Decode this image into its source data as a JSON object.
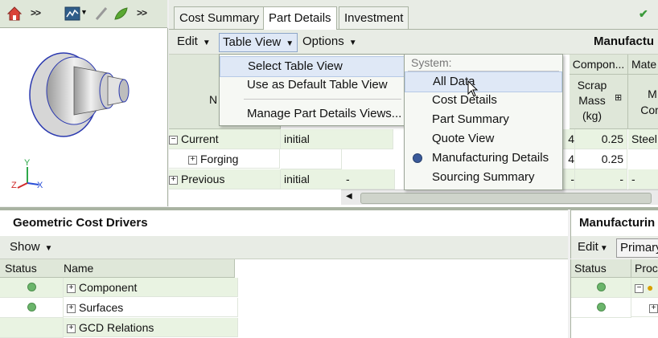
{
  "toolbar_left": {
    "chevron1": ">>",
    "chevron2": ">>"
  },
  "axes": {
    "x": "X",
    "y": "Y",
    "z": "Z"
  },
  "tabs": [
    {
      "label": "Cost Summary"
    },
    {
      "label": "Part Details"
    },
    {
      "label": "Investment"
    }
  ],
  "menubar": {
    "edit": "Edit",
    "table_view": "Table View",
    "options": "Options",
    "right_title": "Manufactu"
  },
  "table_view_menu": {
    "select": "Select Table View",
    "default": "Use as Default Table View",
    "manage": "Manage Part Details Views..."
  },
  "system_menu": {
    "header": "System:",
    "items": [
      "All Data",
      "Cost Details",
      "Part Summary",
      "Quote View",
      "Manufacturing Details",
      "Sourcing Summary"
    ],
    "selected": "Manufacturing Details",
    "hover": "All Data"
  },
  "grid": {
    "col_name_partial": "N",
    "col_compon": "Compon...",
    "col_mate": "Mate",
    "col_scrap": "Scrap Mass (kg)",
    "col_m_com": "M Com",
    "rows": [
      {
        "name": "Current",
        "scenario": "initial",
        "mid": "",
        "p": "4",
        "scrap": "0.25",
        "mat": "Steel",
        "expand": "−"
      },
      {
        "name": "Forging",
        "scenario": "",
        "mid": "",
        "p": "4",
        "scrap": "0.25",
        "mat": "",
        "expand": "+"
      },
      {
        "name": "Previous",
        "scenario": "initial",
        "mid": "-",
        "p": "-",
        "scrap": "-",
        "mat": "-",
        "expand": "+"
      }
    ]
  },
  "gcd": {
    "title": "Geometric Cost Drivers",
    "show": "Show",
    "col_status": "Status",
    "col_name": "Name",
    "rows": [
      {
        "name": "Component",
        "status": true
      },
      {
        "name": "Surfaces",
        "status": true
      },
      {
        "name": "GCD Relations",
        "status": false
      }
    ]
  },
  "mfg": {
    "title": "Manufacturin",
    "edit": "Edit",
    "primary": "Primary",
    "col_status": "Status",
    "col_proc": "Proce"
  },
  "colors": {
    "accent": "#5ea0d6",
    "panel": "#dfe7d9",
    "row_green": "#e9f3e2"
  }
}
